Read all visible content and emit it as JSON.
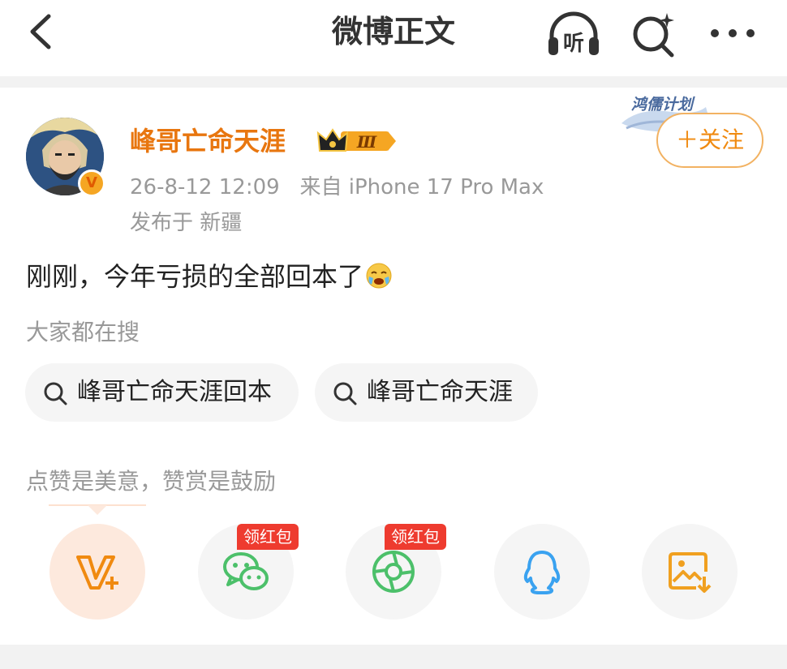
{
  "header": {
    "title": "微博正文",
    "listen_label": "听"
  },
  "post": {
    "author": "峰哥亡命天涯",
    "level_badge": "Ⅲ",
    "verified_mark": "V",
    "timestamp": "26-8-12 12:09",
    "source": "来自 iPhone 17 Pro Max",
    "location": "发布于 新疆",
    "plan_badge": "鸿儒计划",
    "follow_label": "＋关注",
    "text": "刚刚，今年亏损的全部回本了"
  },
  "hot_search": {
    "label": "大家都在搜",
    "chips": [
      {
        "text": "峰哥亡命天涯回本"
      },
      {
        "text": "峰哥亡命天涯"
      }
    ]
  },
  "reward": {
    "label": "点赞是美意，赞赏是鼓励"
  },
  "share": {
    "items": [
      {
        "icon": "v-plus-icon"
      },
      {
        "icon": "wechat-icon",
        "tag": "领红包"
      },
      {
        "icon": "moments-icon",
        "tag": "领红包"
      },
      {
        "icon": "qq-icon"
      },
      {
        "icon": "save-image-icon"
      }
    ]
  },
  "colors": {
    "accent": "#f08a10",
    "username": "#e8760f",
    "red_tag": "#ee3b2f",
    "wechat": "#4cc06a",
    "qq": "#3aa2f0",
    "save": "#f0a020"
  }
}
